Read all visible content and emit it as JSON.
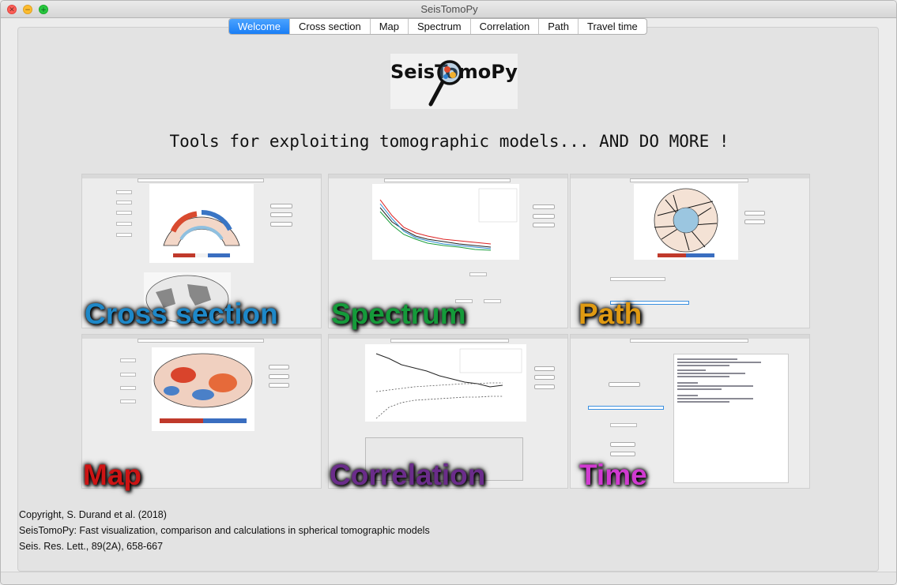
{
  "window": {
    "title": "SeisTomoPy"
  },
  "tabs": [
    "Welcome",
    "Cross section",
    "Map",
    "Spectrum",
    "Correlation",
    "Path",
    "Travel time"
  ],
  "active_tab": "Welcome",
  "logo": {
    "text": "SeisTomoPy"
  },
  "tagline": "Tools for exploiting tomographic models... AND DO MORE !",
  "panels": [
    {
      "label": "Cross section",
      "color": "#1e88c8"
    },
    {
      "label": "Spectrum",
      "color": "#159a3a"
    },
    {
      "label": "Path",
      "color": "#e09a12"
    },
    {
      "label": "Map",
      "color": "#cc1414"
    },
    {
      "label": "Correlation",
      "color": "#6a2c8a"
    },
    {
      "label": "Time",
      "color": "#d03ad0"
    }
  ],
  "credits": {
    "line1": "Copyright, S. Durand et al. (2018)",
    "line2": "SeisTomoPy: Fast visualization, comparison and calculations in spherical tomographic models",
    "line3": "Seis. Res. Lett., 89(2A), 658-667"
  },
  "colors": {
    "accent": "#1a7ef5"
  }
}
